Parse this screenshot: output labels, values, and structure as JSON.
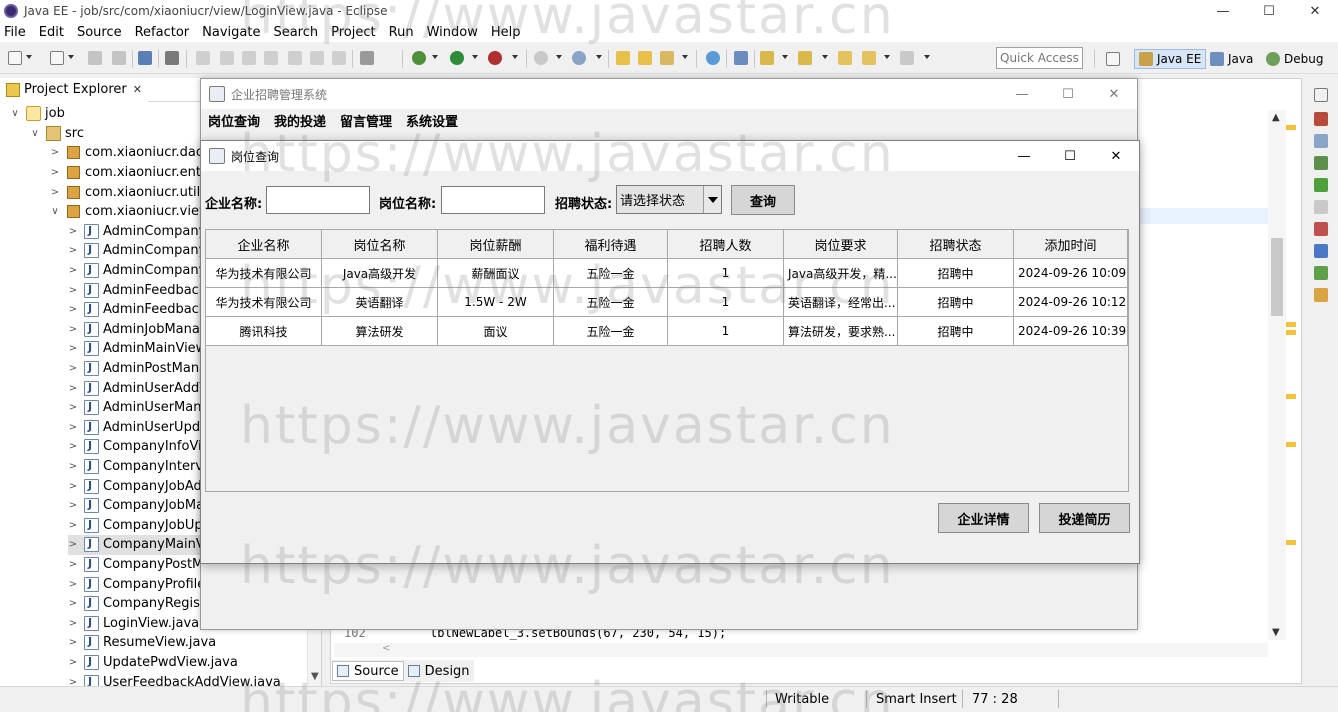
{
  "eclipse": {
    "title": "Java EE - job/src/com/xiaoniucr/view/LoginView.java - Eclipse",
    "menu": [
      "File",
      "Edit",
      "Source",
      "Refactor",
      "Navigate",
      "Search",
      "Project",
      "Run",
      "Window",
      "Help"
    ],
    "quick_access": "Quick Access",
    "perspectives": {
      "javaee": "Java EE",
      "java": "Java",
      "debug": "Debug"
    },
    "window_buttons": {
      "minimize": "—",
      "maximize": "☐",
      "close": "✕"
    }
  },
  "explorer": {
    "tab_label": "Project Explorer",
    "tab_close": "✕",
    "tree": [
      {
        "label": "job",
        "type": "project",
        "expanded": true
      },
      {
        "label": "src",
        "type": "src",
        "expanded": true
      },
      {
        "label": "com.xiaoniucr.dao",
        "type": "pkg",
        "expanded": false
      },
      {
        "label": "com.xiaoniucr.entity",
        "type": "pkg",
        "expanded": false
      },
      {
        "label": "com.xiaoniucr.utils",
        "type": "pkg",
        "expanded": false
      },
      {
        "label": "com.xiaoniucr.view",
        "type": "pkg",
        "expanded": true
      },
      {
        "label": "AdminCompanyAddView.java",
        "type": "java"
      },
      {
        "label": "AdminCompanyManageView.java",
        "type": "java"
      },
      {
        "label": "AdminCompanyUpdateView.java",
        "type": "java"
      },
      {
        "label": "AdminFeedbackManageView.java",
        "type": "java"
      },
      {
        "label": "AdminFeedbackReplyView.java",
        "type": "java"
      },
      {
        "label": "AdminJobManageView.java",
        "type": "java"
      },
      {
        "label": "AdminMainView.java",
        "type": "java"
      },
      {
        "label": "AdminPostManageView.java",
        "type": "java"
      },
      {
        "label": "AdminUserAddView.java",
        "type": "java"
      },
      {
        "label": "AdminUserManageView.java",
        "type": "java"
      },
      {
        "label": "AdminUserUpdateView.java",
        "type": "java"
      },
      {
        "label": "CompanyInfoView.java",
        "type": "java"
      },
      {
        "label": "CompanyInterviewView.java",
        "type": "java"
      },
      {
        "label": "CompanyJobAddView.java",
        "type": "java"
      },
      {
        "label": "CompanyJobManageView.java",
        "type": "java"
      },
      {
        "label": "CompanyJobUpdateView.java",
        "type": "java"
      },
      {
        "label": "CompanyMainView.java",
        "type": "java",
        "selected": true
      },
      {
        "label": "CompanyPostManageView.java",
        "type": "java"
      },
      {
        "label": "CompanyProfileView.java",
        "type": "java"
      },
      {
        "label": "CompanyRegisterView.java",
        "type": "java"
      },
      {
        "label": "LoginView.java",
        "type": "java"
      },
      {
        "label": "ResumeView.java",
        "type": "java"
      },
      {
        "label": "UpdatePwdView.java",
        "type": "java"
      },
      {
        "label": "UserFeedbackAddView.java",
        "type": "java"
      }
    ]
  },
  "editor": {
    "line_number": "102",
    "code": "lblNewLabel_3.setBounds(67, 230, 54, 15);",
    "tabs": {
      "source": "Source",
      "design": "Design"
    }
  },
  "statusbar": {
    "writable": "Writable",
    "insert_mode": "Smart Insert",
    "position": "77 : 28"
  },
  "main_window": {
    "title": "企业招聘管理系统",
    "menu": [
      "岗位查询",
      "我的投递",
      "留言管理",
      "系统设置"
    ]
  },
  "dialog": {
    "title": "岗位查询",
    "company_label": "企业名称:",
    "company_value": "",
    "job_label": "岗位名称:",
    "job_value": "",
    "status_label": "招聘状态:",
    "status_selected": "请选择状态",
    "search_button": "查询",
    "detail_button": "企业详情",
    "apply_button": "投递简历",
    "table": {
      "columns": [
        "企业名称",
        "岗位名称",
        "岗位薪酬",
        "福利待遇",
        "招聘人数",
        "岗位要求",
        "招聘状态",
        "添加时间"
      ],
      "rows": [
        [
          "华为技术有限公司",
          "Java高级开发",
          "薪酬面议",
          "五险一金",
          "1",
          "Java高级开发，精...",
          "招聘中",
          "2024-09-26 10:09:..."
        ],
        [
          "华为技术有限公司",
          "英语翻译",
          "1.5W - 2W",
          "五险一金",
          "1",
          "英语翻译，经常出...",
          "招聘中",
          "2024-09-26 10:12:..."
        ],
        [
          "腾讯科技",
          "算法研发",
          "面议",
          "五险一金",
          "1",
          "算法研发，要求熟...",
          "招聘中",
          "2024-09-26 10:39:..."
        ]
      ]
    }
  },
  "watermark": "https://www.javastar.cn"
}
